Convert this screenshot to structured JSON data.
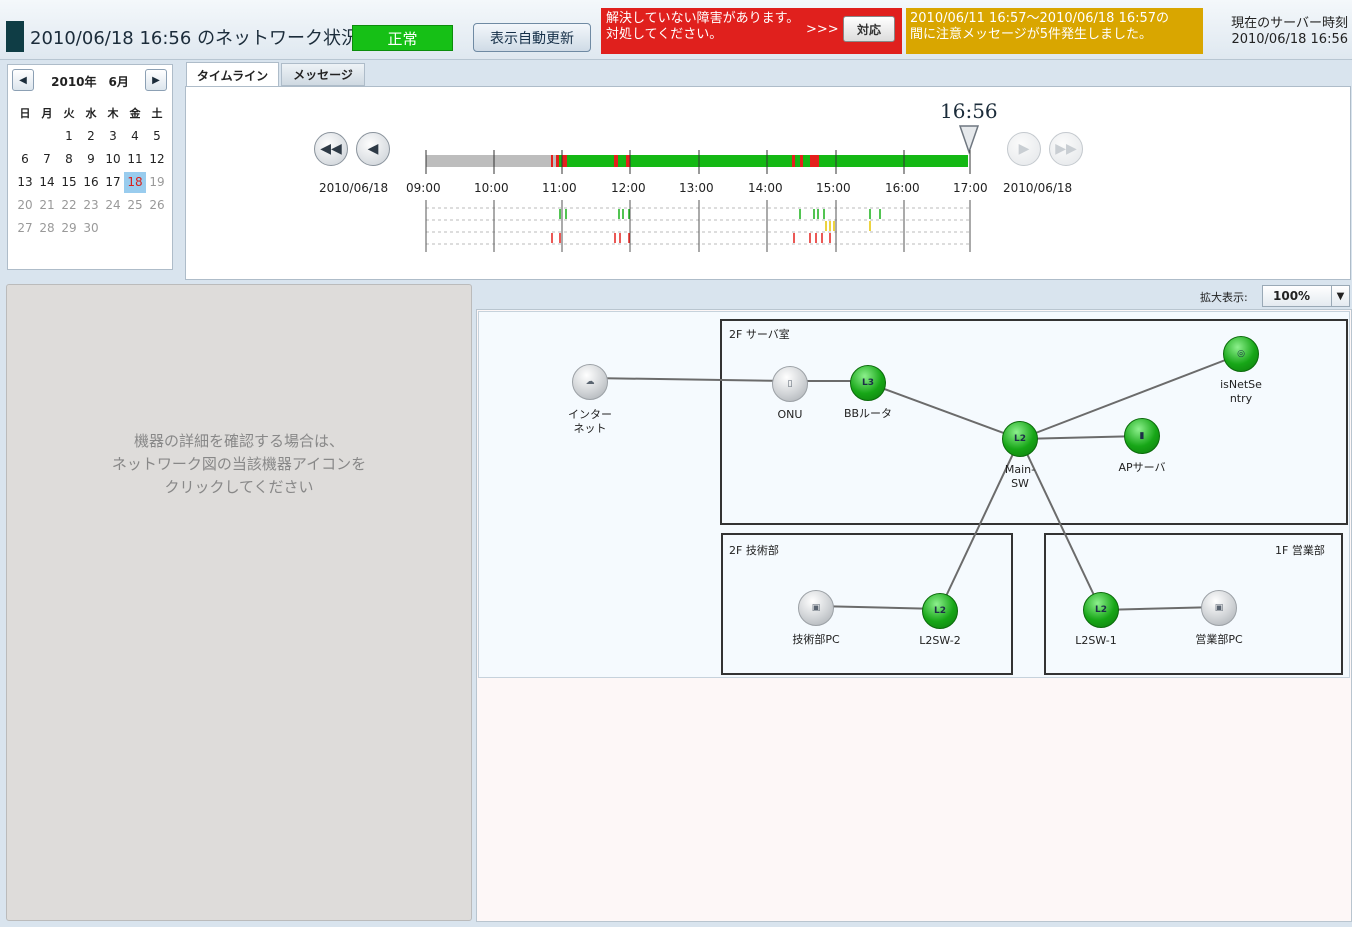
{
  "header": {
    "title": "2010/06/18 16:56 のネットワーク状況",
    "status": "正常",
    "auto_refresh": "表示自動更新",
    "alert_red_line1": "解決していない障害があります。",
    "alert_red_line2": "対処してください。",
    "alert_arrows": ">>>",
    "respond_button": "対応",
    "alert_yellow_line1": "2010/06/11 16:57～2010/06/18 16:57の",
    "alert_yellow_line2": "間に注意メッセージが5件発生しました。",
    "server_time_label": "現在のサーバー時刻",
    "server_time_value": "2010/06/18 16:56"
  },
  "calendar": {
    "year_month": "2010年　6月",
    "weekdays": [
      "日",
      "月",
      "火",
      "水",
      "木",
      "金",
      "土"
    ],
    "weeks": [
      [
        "",
        "",
        "1",
        "2",
        "3",
        "4",
        "5"
      ],
      [
        "6",
        "7",
        "8",
        "9",
        "10",
        "11",
        "12"
      ],
      [
        "13",
        "14",
        "15",
        "16",
        "17",
        "18",
        "19"
      ],
      [
        "20",
        "21",
        "22",
        "23",
        "24",
        "25",
        "26"
      ],
      [
        "27",
        "28",
        "29",
        "30",
        "",
        "",
        ""
      ]
    ],
    "selected_day": "18"
  },
  "tabs": {
    "timeline": "タイムライン",
    "messages": "メッセージ"
  },
  "timeline": {
    "current_time": "16:56",
    "start_date": "2010/06/18",
    "end_date": "2010/06/18",
    "hours": [
      "09:00",
      "10:00",
      "11:00",
      "12:00",
      "13:00",
      "14:00",
      "15:00",
      "16:00",
      "17:00"
    ]
  },
  "detail": {
    "hint_line1": "機器の詳細を確認する場合は、",
    "hint_line2": "ネットワーク図の当該機器アイコンを",
    "hint_line3": "クリックしてください"
  },
  "map": {
    "zoom_label": "拡大表示:",
    "zoom_value": "100%",
    "zones": {
      "server_room": "2F サーバ室",
      "engineering": "2F 技術部",
      "sales": "1F 営業部"
    },
    "nodes": {
      "internet_line1": "インター",
      "internet_line2": "ネット",
      "onu": "ONU",
      "bb_router": "BBルータ",
      "main_sw_line1": "Main-",
      "main_sw_line2": "SW",
      "ap_server": "APサーバ",
      "isnetsentry_line1": "isNetSe",
      "isnetsentry_line2": "ntry",
      "eng_pc": "技術部PC",
      "l2sw2": "L2SW-2",
      "l2sw1": "L2SW-1",
      "sales_pc": "営業部PC"
    }
  },
  "colors": {
    "ok": "#16c016",
    "alert": "#e0201d",
    "warning": "#d9a600",
    "selected_day_bg": "#99ccee"
  },
  "icons": {
    "rewind": "double-left-arrow-icon",
    "back": "left-arrow-icon",
    "forward": "right-arrow-icon",
    "fast_forward": "double-right-arrow-icon",
    "marker": "triangle-down-icon",
    "dropdown": "chevron-down-icon"
  }
}
